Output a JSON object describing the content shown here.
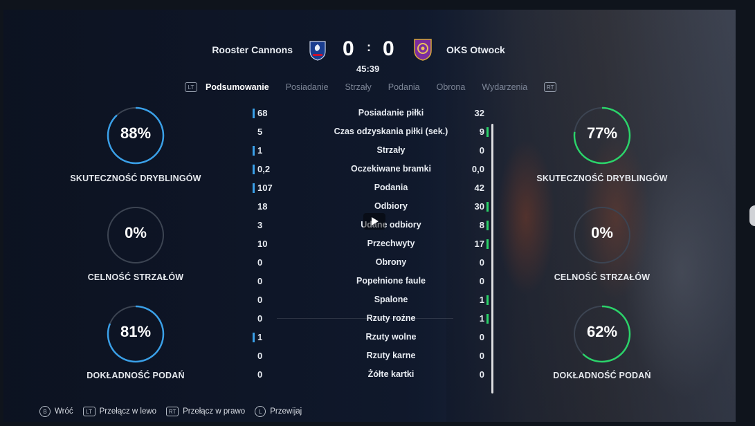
{
  "match": {
    "home_team": "Rooster Cannons",
    "away_team": "OKS Otwock",
    "home_score": "0",
    "away_score": "0",
    "separator": ":",
    "clock": "45:39"
  },
  "tabs": {
    "left_button": "LT",
    "right_button": "RT",
    "items": [
      "Podsumowanie",
      "Posiadanie",
      "Strzały",
      "Podania",
      "Obrona",
      "Wydarzenia"
    ],
    "active_index": 0
  },
  "home_rings": [
    {
      "value": "88%",
      "fraction": 0.88,
      "label": "SKUTECZNOŚĆ DRYBLINGÓW"
    },
    {
      "value": "0%",
      "fraction": 0.0,
      "label": "CELNOŚĆ STRZAŁÓW"
    },
    {
      "value": "81%",
      "fraction": 0.81,
      "label": "DOKŁADNOŚĆ PODAŃ"
    }
  ],
  "away_rings": [
    {
      "value": "77%",
      "fraction": 0.77,
      "label": "SKUTECZNOŚĆ DRYBLINGÓW"
    },
    {
      "value": "0%",
      "fraction": 0.0,
      "label": "CELNOŚĆ STRZAŁÓW"
    },
    {
      "value": "62%",
      "fraction": 0.62,
      "label": "DOKŁADNOŚĆ PODAŃ"
    }
  ],
  "stats": [
    {
      "label": "Posiadanie piłki",
      "home": "68",
      "away": "32",
      "leader": "home"
    },
    {
      "label": "Czas odzyskania piłki (sek.)",
      "home": "5",
      "away": "9",
      "leader": "away"
    },
    {
      "label": "Strzały",
      "home": "1",
      "away": "0",
      "leader": "home"
    },
    {
      "label": "Oczekiwane bramki",
      "home": "0,2",
      "away": "0,0",
      "leader": "home"
    },
    {
      "label": "Podania",
      "home": "107",
      "away": "42",
      "leader": "home"
    },
    {
      "label": "Odbiory",
      "home": "18",
      "away": "30",
      "leader": "away"
    },
    {
      "label": "Udane odbiory",
      "home": "3",
      "away": "8",
      "leader": "away"
    },
    {
      "label": "Przechwyty",
      "home": "10",
      "away": "17",
      "leader": "away"
    },
    {
      "label": "Obrony",
      "home": "0",
      "away": "0",
      "leader": "none"
    },
    {
      "label": "Popełnione faule",
      "home": "0",
      "away": "0",
      "leader": "none"
    },
    {
      "label": "Spalone",
      "home": "0",
      "away": "1",
      "leader": "away"
    },
    {
      "label": "Rzuty rożne",
      "home": "0",
      "away": "1",
      "leader": "away"
    },
    {
      "label": "Rzuty wolne",
      "home": "1",
      "away": "0",
      "leader": "home"
    },
    {
      "label": "Rzuty karne",
      "home": "0",
      "away": "0",
      "leader": "none"
    },
    {
      "label": "Żółte kartki",
      "home": "0",
      "away": "0",
      "leader": "none"
    }
  ],
  "footer": [
    {
      "icon": "b-button-icon",
      "label": "Wróć"
    },
    {
      "icon": "lt-button-icon",
      "label": "Przełącz w lewo"
    },
    {
      "icon": "rt-button-icon",
      "label": "Przełącz w prawo"
    },
    {
      "icon": "left-stick-icon",
      "label": "Przewijaj"
    }
  ],
  "colors": {
    "home_accent": "#3aa0e8",
    "away_accent": "#2bd46a",
    "ring_track": "#3c4452"
  }
}
